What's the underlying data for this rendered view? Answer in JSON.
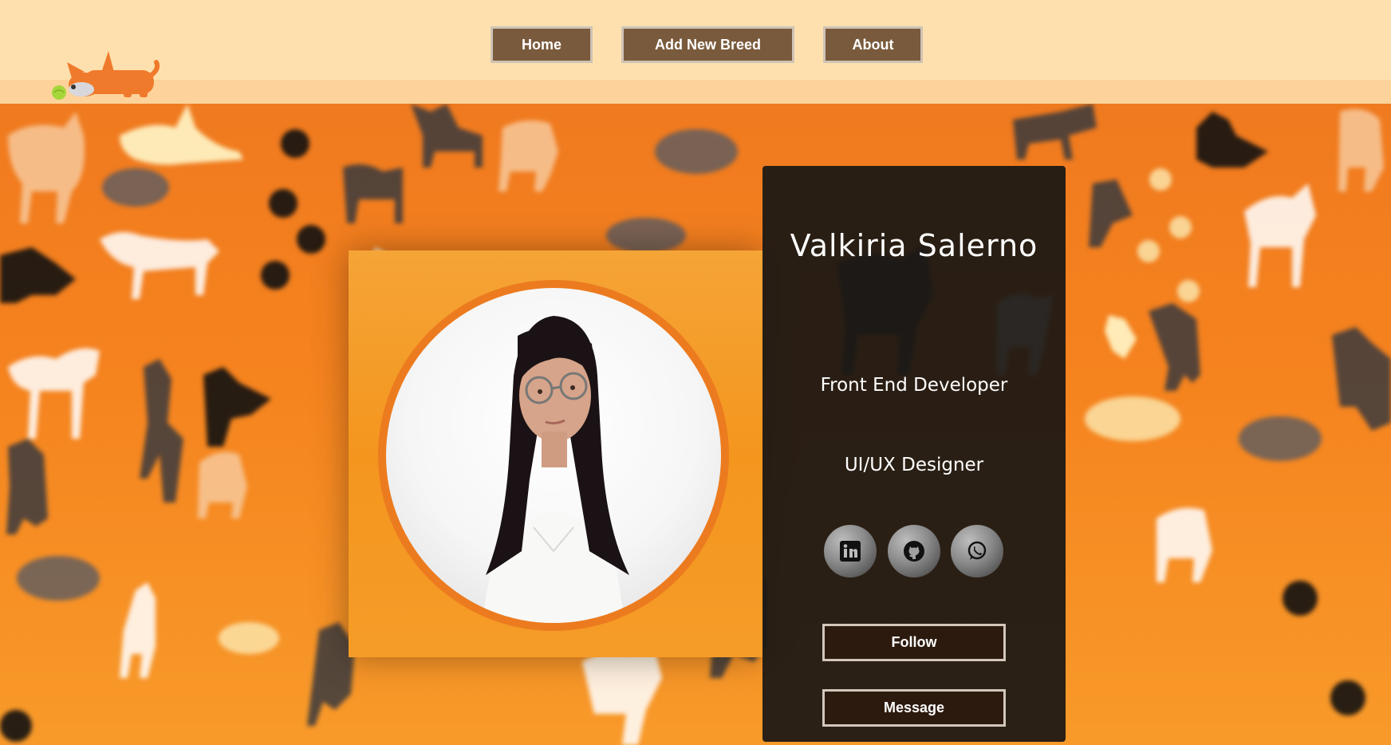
{
  "header": {
    "logo_icon": "dog-with-ball-icon",
    "nav": [
      {
        "label": "Home"
      },
      {
        "label": "Add New Breed"
      },
      {
        "label": "About"
      }
    ]
  },
  "background": {
    "pattern": "dog-silhouettes-pattern",
    "colors": {
      "top": "#f07a1f",
      "bottom": "#f89a2a"
    }
  },
  "profile": {
    "name": "Valkiria Salerno",
    "roles": [
      "Front End Developer",
      "UI/UX Designer"
    ],
    "photo": "profile-photo",
    "social": [
      {
        "name": "linkedin-icon"
      },
      {
        "name": "github-icon"
      },
      {
        "name": "whatsapp-icon"
      }
    ],
    "actions": {
      "follow": "Follow",
      "message": "Message"
    }
  },
  "colors": {
    "header_bg": "#fde0ad",
    "nav_button_bg": "#7a5a3c",
    "card_bg": "#181614",
    "action_button_bg": "#2d1a0e",
    "ring": "#ec7b1f"
  }
}
